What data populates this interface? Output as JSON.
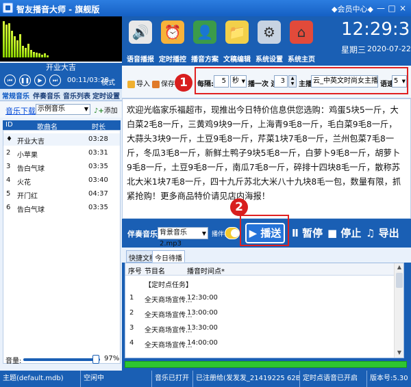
{
  "window": {
    "title": "智友播音大师 - 旗舰版",
    "member_center": "◆会员中心◆",
    "controls": [
      "—",
      "□",
      "×"
    ]
  },
  "player": {
    "song_title": "开业大吉",
    "time": "00:11/03:28",
    "mode": "模式",
    "visualizer_levels": [
      0.95,
      0.85,
      0.9,
      0.7,
      0.55,
      0.45,
      0.6,
      0.3,
      0.25,
      0.35,
      0.2,
      0.15,
      0.12,
      0.1,
      0.08,
      0.1,
      0.06
    ]
  },
  "left_tabs": [
    "常规音乐",
    "伴奏音乐",
    "音乐列表",
    "定时设置"
  ],
  "music": {
    "download_link": "音乐下载",
    "category": "示例音乐",
    "add_label": "添加"
  },
  "playlist": {
    "headers": [
      "ID",
      "歌曲名",
      "时长"
    ],
    "rows": [
      {
        "id": "♦",
        "name": "开业大吉",
        "duration": "03:28"
      },
      {
        "id": "2",
        "name": "小苹果",
        "duration": "03:31"
      },
      {
        "id": "3",
        "name": "告白气球",
        "duration": "03:35"
      },
      {
        "id": "4",
        "name": "火花",
        "duration": "03:40"
      },
      {
        "id": "5",
        "name": "开门红",
        "duration": "04:37"
      },
      {
        "id": "6",
        "name": "告白气球",
        "duration": "03:35"
      }
    ]
  },
  "volume": {
    "label": "音量:",
    "percent": "97%",
    "level": 0.97
  },
  "toolbar": [
    {
      "label": "语音播报",
      "color": "#e8e8e8"
    },
    {
      "label": "定时播控",
      "color": "#f7b23a"
    },
    {
      "label": "播音方案",
      "color": "#3b9b4a"
    },
    {
      "label": "文稿编辑",
      "color": "#f2d04a"
    },
    {
      "label": "系统设置",
      "color": "#c7d3e2"
    },
    {
      "label": "系统主页",
      "color": "#e24a3a"
    }
  ],
  "clock": {
    "time": "12:29:33",
    "weekday": "星期三",
    "date": "2020-07-22"
  },
  "settings": {
    "import_label": "导入",
    "save_label": "保存",
    "every_label": "每隔:",
    "every_value": "5",
    "unit_value": "秒",
    "once_label": "播一次 连播",
    "repeat_value": "3",
    "voice_label": "主播:",
    "voice_value": "云_中英文时尚女主播(",
    "speed_label": "语速:",
    "speed_value": "5"
  },
  "badges": {
    "one": "1",
    "two": "2"
  },
  "announcement": "欢迎光临家乐福超市，现推出今日特价信息供您选购：鸡蛋5块5一斤，大白菜2毛8一斤，三黄鸡9块9一斤，上海青9毛8一斤，毛白菜9毛8一斤，大蒜头3块9一斤，土豆9毛8一斤，芹菜1块7毛8一斤，兰州包菜7毛8一斤，冬瓜3毛8一斤，新鲜土鸭子9块5毛8一斤，白萝卜9毛8一斤，胡萝卜9毛8一斤，土豆9毛8一斤，南瓜7毛8一斤，碎排十四块8毛一斤，散称苏北大米1块7毛8一斤，四十九斤苏北大米八十九块8毛一包，数量有限，抓紧抢购！更多商品特价请见店内海报！",
  "playbar": {
    "bgm_label": "伴奏音乐:",
    "bgm_value": "背景音乐2.mp3",
    "bgm_toggle_label": "播伴奏",
    "play": "▶ 播送",
    "pause": "Ⅱ 暂停",
    "stop": "■ 停止",
    "export": "♫ 导出"
  },
  "schedule_tabs": [
    "快捷文稿",
    "今日待播"
  ],
  "schedule": {
    "headers": [
      "序号",
      "节目名",
      "播音时间点*"
    ],
    "rows": [
      {
        "no": "",
        "name": "【定时点任务】",
        "time": ""
      },
      {
        "no": "1",
        "name": "全天商场宣传...",
        "time": "12:30:00"
      },
      {
        "no": "2",
        "name": "全天商场宣传...",
        "time": "13:00:00"
      },
      {
        "no": "3",
        "name": "全天商场宣传...",
        "time": "13:30:00"
      },
      {
        "no": "4",
        "name": "全天商场宣传...",
        "time": "14:00:00"
      }
    ]
  },
  "statusbar": [
    "主题(default.mdb)",
    "空闲中",
    "音乐已打开",
    "已注册给(发发发_21419225 62BFEBFBFF00030",
    "定时点语音已开启",
    "版本号:5.30"
  ]
}
